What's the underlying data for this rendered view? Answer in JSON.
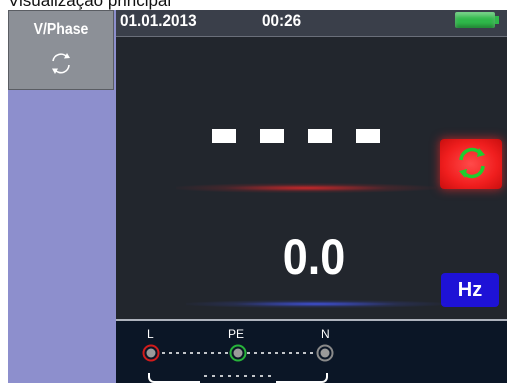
{
  "caption": "Visualização principal",
  "sidebar": {
    "function_label": "V/Phase",
    "function_icon": "rotation-cycle-icon"
  },
  "status": {
    "date": "01.01.2013",
    "time": "00:26",
    "battery_icon": "battery-full-icon",
    "battery_color": "#2fb84a"
  },
  "display": {
    "voltage_reading": "- - - -",
    "rotation_indicator_icon": "phase-rotation-icon",
    "rotation_indicator_color": "#f01e1e",
    "frequency_value": "0.0",
    "frequency_unit": "Hz",
    "unit_badge_color": "#1e12d6"
  },
  "terminals": {
    "items": [
      {
        "label": "L",
        "ring_color": "#d11b1b"
      },
      {
        "label": "PE",
        "ring_color": "#27b33a"
      },
      {
        "label": "N",
        "ring_color": "#8a8a8a"
      }
    ]
  }
}
